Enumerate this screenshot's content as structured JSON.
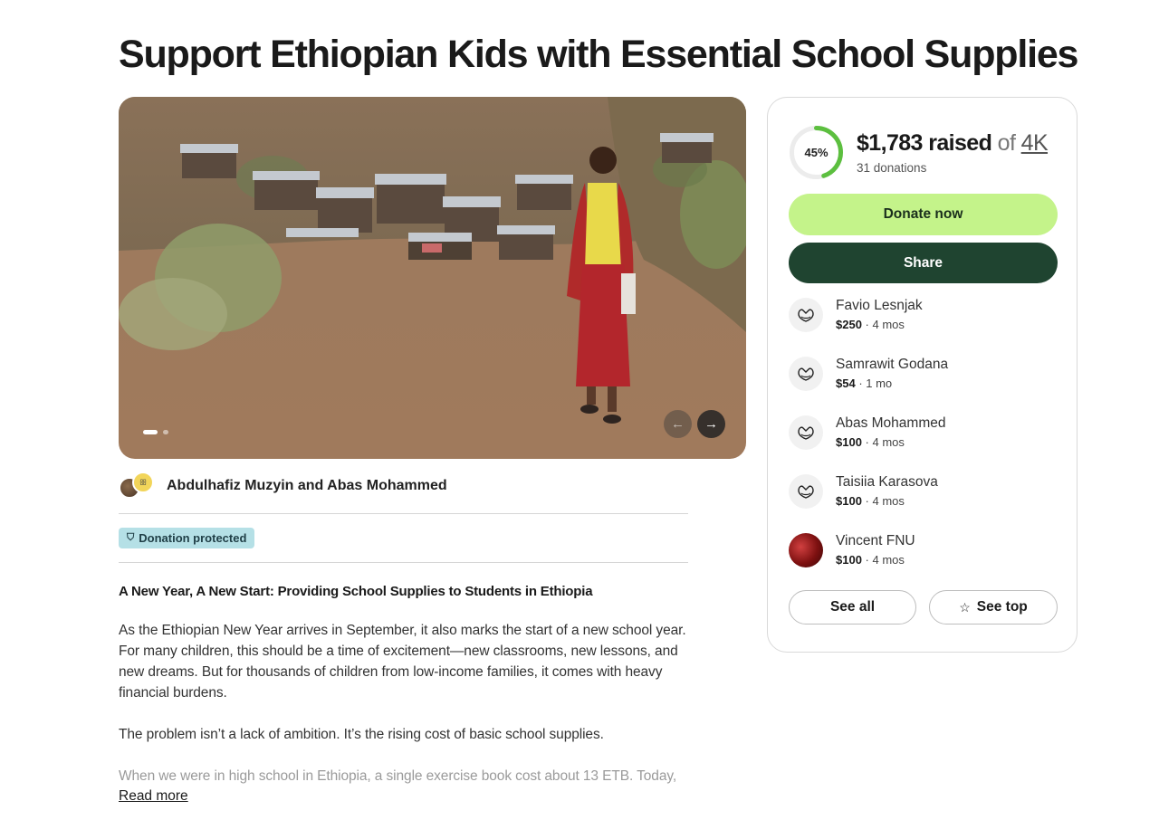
{
  "page": {
    "title": "Support Ethiopian Kids with Essential School Supplies"
  },
  "gallery": {
    "prev_icon": "arrow-left-icon",
    "next_icon": "arrow-right-icon",
    "prev_glyph": "←",
    "next_glyph": "→",
    "slide_count": 2,
    "active_slide": 1
  },
  "organizer": {
    "names": "Abdulhafiz Muzyin and Abas Mohammed",
    "avatar_text": "ꕥ"
  },
  "badge": {
    "label": "Donation protected",
    "icon": "shield-icon",
    "glyph": "⛉"
  },
  "story": {
    "heading": "A New Year, A New Start: Providing School Supplies to Students in Ethiopia",
    "paragraphs": [
      "As the Ethiopian New Year arrives in September, it also marks the start of a new school year. For many children, this should be a time of excitement—new classrooms, new lessons, and new dreams. But for thousands of children from low-income families, it comes with heavy financial burdens.",
      "The problem isn’t a lack of ambition. It’s the rising cost of basic school supplies.",
      "When we were in high school in Ethiopia, a single exercise book cost about 13 ETB. Today,"
    ],
    "read_more": "Read more"
  },
  "fundraiser": {
    "progress_percent": 45,
    "progress_label": "45%",
    "raised": "$1,783 raised",
    "of": "of",
    "goal": "4K",
    "donations": "31 donations",
    "donate_label": "Donate now",
    "share_label": "Share",
    "accent_color": "#c4f38a",
    "share_color": "#1f4430",
    "ring_color": "#5cbf3f"
  },
  "donors": [
    {
      "name": "Favio Lesnjak",
      "amount": "$250",
      "time": " · 4 mos",
      "icon": "donation-hands-icon"
    },
    {
      "name": "Samrawit Godana",
      "amount": "$54",
      "time": " · 1 mo",
      "icon": "donation-hands-icon"
    },
    {
      "name": "Abas Mohammed",
      "amount": "$100",
      "time": " · 4 mos",
      "icon": "donation-hands-icon"
    },
    {
      "name": "Taisiia Karasova",
      "amount": "$100",
      "time": " · 4 mos",
      "icon": "donation-hands-icon"
    },
    {
      "name": "Vincent FNU",
      "amount": "$100",
      "time": " · 4 mos",
      "icon": "profile-photo"
    }
  ],
  "actions": {
    "see_all": "See all",
    "see_top": "See top",
    "star_glyph": "☆"
  }
}
